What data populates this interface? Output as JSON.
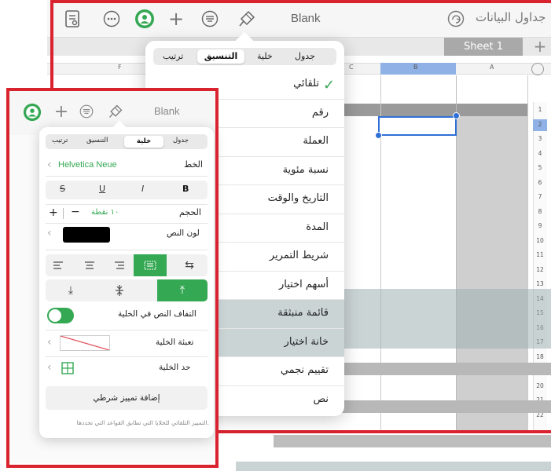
{
  "back": {
    "toolbar": {
      "title": "Blank",
      "app_name": "جداول البيانات"
    },
    "sheet_tab": "Sheet 1",
    "col_headers": [
      "F",
      "C",
      "B",
      "A"
    ],
    "row_numbers": [
      "1",
      "2",
      "3",
      "4",
      "5",
      "6",
      "7",
      "8",
      "9",
      "10",
      "11",
      "12",
      "13",
      "14",
      "15",
      "16",
      "17",
      "18",
      "19",
      "20",
      "21",
      "22"
    ]
  },
  "format_menu": {
    "tabs": [
      "جدول",
      "خلية",
      "التنسيق",
      "ترتيب"
    ],
    "items": [
      "تلقائي",
      "رقم",
      "العملة",
      "نسبة مئوية",
      "التاريخ والوقت",
      "المدة",
      "شريط التمرير",
      "أسهم اختيار",
      "قائمة منبثقة",
      "خانة اختيار",
      "تقييم نجمي",
      "نص"
    ]
  },
  "front": {
    "toolbar": {
      "title": "Blank"
    },
    "tabs": [
      "جدول",
      "خلية",
      "التنسيق",
      "ترتيب"
    ],
    "font_label": "الخط",
    "font_name": "Helvetica Neue",
    "style_buttons": [
      "B",
      "I",
      "U",
      "S"
    ],
    "size_label": "الحجم",
    "size_value": "١٠ نقطة",
    "size_minus": "−",
    "size_plus": "+",
    "text_color_label": "لون النص",
    "wrap_label": "التفاف النص في الخلية",
    "cell_fill_label": "تعبئة الخلية",
    "cell_border_label": "حد الخلية",
    "conditional_button": "إضافة تمييز شرطي",
    "footnote": "التمييز التلقائي للخلايا التي تطابق القواعد التي تحددها."
  },
  "colors": {
    "accent": "#34a853",
    "frame": "#d9232e",
    "selection": "#2f6fd6"
  }
}
